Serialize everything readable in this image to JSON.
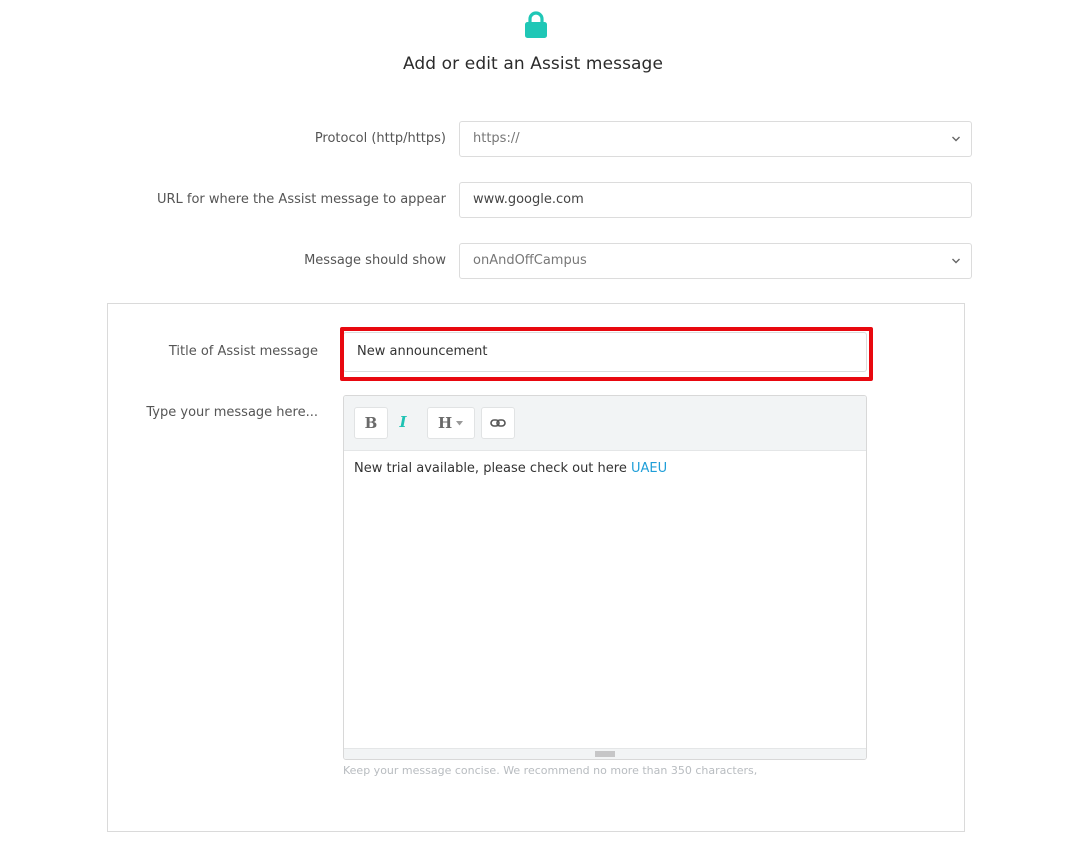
{
  "header": {
    "icon": "lock-icon",
    "icon_color": "#1fc7b6",
    "title": "Add or edit an Assist message"
  },
  "form": {
    "protocol": {
      "label": "Protocol (http/https)",
      "value": "https://"
    },
    "url": {
      "label": "URL for where the Assist message to appear",
      "value": "www.google.com"
    },
    "show": {
      "label": "Message should show",
      "value": "onAndOffCampus"
    }
  },
  "panel": {
    "title": {
      "label": "Title of Assist message",
      "value": "New announcement"
    },
    "message": {
      "label": "Type your message here...",
      "toolbar": {
        "bold": "B",
        "italic": "I",
        "heading": "H"
      },
      "content_text": "New trial available, please check out here ",
      "content_link": "UAEU",
      "hint": "Keep your message concise. We recommend no more than 350 characters,"
    },
    "highlight_color": "#e8080f"
  },
  "colors": {
    "accent": "#1fc7b6",
    "link": "#1e9ed8"
  }
}
